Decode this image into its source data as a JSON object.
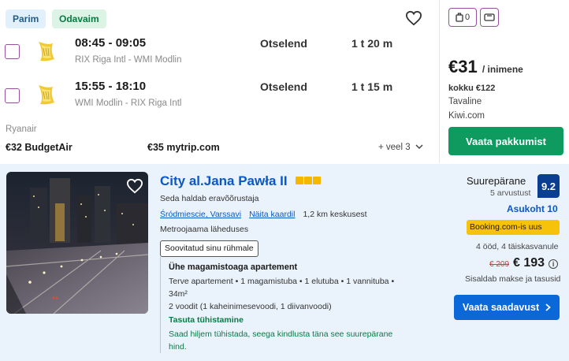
{
  "flight": {
    "tags": {
      "best": "Parim",
      "cheapest": "Odavaim"
    },
    "outbound": {
      "times": "08:45 - 09:05",
      "route": "RIX Riga Intl - WMI Modlin",
      "stops": "Otselend",
      "duration": "1 t 20 m"
    },
    "inbound": {
      "times": "15:55 - 18:10",
      "route": "WMI Modlin - RIX Riga Intl",
      "stops": "Otselend",
      "duration": "1 t 15 m"
    },
    "carrier": "Ryanair",
    "alt_prices": [
      {
        "price": "€32",
        "provider": "BudgetAir"
      },
      {
        "price": "€35",
        "provider": "mytrip.com"
      }
    ],
    "more_label": "+ veel 3",
    "bags": {
      "cabin_count": "0"
    },
    "price": "€31",
    "price_unit": "/ inimene",
    "total": "kokku €122",
    "fare_type": "Tavaline",
    "provider": "Kiwi.com",
    "cta": "Vaata pakkumist",
    "colors": {
      "cta": "#0f9a5f",
      "tag_best": "#e1f0fb",
      "tag_cheap": "#dcf3e6"
    }
  },
  "hotel": {
    "name": "City al.Jana Pawła II",
    "stars": 3,
    "host": "Seda haldab eravõõrustaja",
    "district": "Śródmiescie, Varssavi",
    "map_link": "Näita kaardil",
    "distance": "1,2 km keskusest",
    "metro": "Metroojaama läheduses",
    "recommended": "Soovitatud sinu rühmale",
    "room_title": "Ühe magamistoaga apartement",
    "room_desc": "Terve apartement • 1 magamistuba • 1 elutuba • 1 vannituba • 34m²",
    "beds": "2 voodit (1 kaheinimesevoodi, 1 diivanvoodi)",
    "free_cancel": "Tasuta tühistamine",
    "cancel_note": "Saad hiljem tühistada, seega kindlusta täna see suurepärane hind.",
    "rating_word": "Suurepärane",
    "reviews": "5 arvustust",
    "score": "9.2",
    "location_score": "Asukoht 10",
    "source": "Booking.com-is uus",
    "nights": "4 ööd, 4 täiskasvanule",
    "old_price": "€ 209",
    "price": "€ 193",
    "taxes": "Sisaldab makse ja tasusid",
    "cta": "Vaata saadavust",
    "colors": {
      "background": "#eaf3fc",
      "link": "#0a57c7",
      "cta": "#0a68d8",
      "score": "#0b3d91",
      "source": "#f7c20a"
    }
  }
}
